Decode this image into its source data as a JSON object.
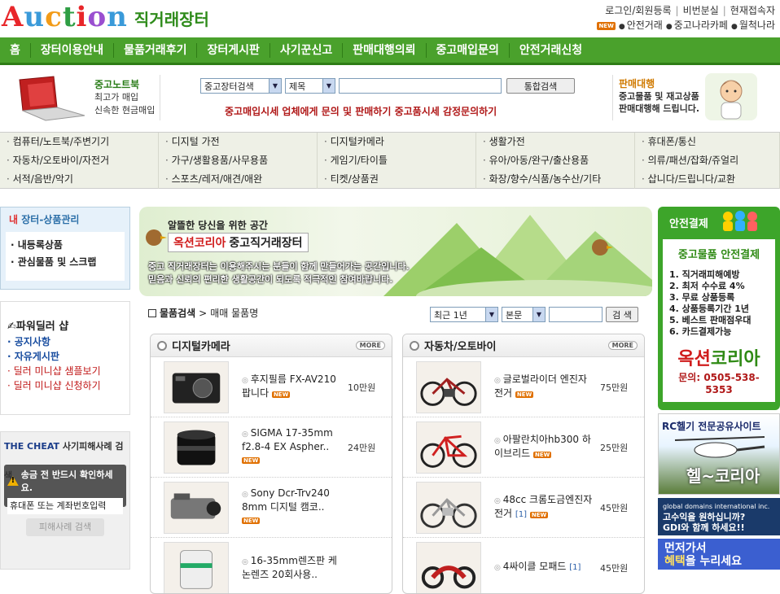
{
  "header": {
    "logo": "Auction",
    "logo_sub": "직거래장터",
    "links_top": [
      "로그인/회원등록",
      "비번분실",
      "현재접속자"
    ],
    "links_bottom": [
      "안전거래",
      "중고나라카페",
      "월척나라"
    ],
    "new_label": "NEW"
  },
  "nav": {
    "items": [
      "홈",
      "장터이용안내",
      "물품거래후기",
      "장터게시판",
      "사기꾼신고",
      "판매대행의뢰",
      "중고매입문의",
      "안전거래신청"
    ]
  },
  "promo": {
    "left_title": "중고노트북",
    "left_lines": [
      "최고가 매입",
      "신속한 현금매입"
    ],
    "search_scope": "중고장터검색",
    "search_field": "제목",
    "search_button": "통합검색",
    "notice": "중고매입시세 업체에게 문의 및 판매하기 중고품시세 감정문의하기",
    "right_title": "판매대행",
    "right_lines": [
      "중고물품 및 재고상품",
      "판매대행해 드립니다."
    ]
  },
  "categories": [
    "컴퓨터/노트북/주변기기",
    "디지털 가전",
    "디지털카메라",
    "생활가전",
    "휴대폰/통신",
    "자동차/오토바이/자전거",
    "가구/생활용품/사무용품",
    "게임기/타이틀",
    "유아/아동/완구/출산용품",
    "의류/패션/잡화/쥬얼리",
    "서적/음반/악기",
    "스포츠/레저/애견/애완",
    "티켓/상품권",
    "화장/향수/식품/농수산/기타",
    "삽니다/드립니다/교환"
  ],
  "sidebar": {
    "title_prefix": "내",
    "title": "장터-상품관리",
    "items": [
      "· 내등록상품",
      "· 관심물품 및 스크랩"
    ],
    "power_title": "파워딜러 샵",
    "power_links": [
      "· 공지사항",
      "· 자유게시판"
    ],
    "dealer_links": [
      "· 딜러 미니샵 샘플보기",
      "· 딜러 미니샵 신청하기"
    ],
    "cheat_brand": "THE CHEAT",
    "cheat_title": "사기피해사례 검색",
    "cheat_warn": "송금 전 반드시 확인하세요.",
    "cheat_placeholder": "휴대폰 또는 계좌번호입력",
    "cheat_button": "피해사례 검색"
  },
  "banner": {
    "tagline": "알뜰한 당신을 위한 공간",
    "name": "옥션코리아",
    "name_suffix": "중고직거래장터",
    "desc1": "중고 직거래장터는 이용해주시는 분들이 함께 만들어가는 공간입니다.",
    "desc2": "믿음과 신뢰의 편리한 생활공간이 되도록 적극적인 참여바랍니다."
  },
  "list": {
    "breadcrumb_1": "물품검색",
    "breadcrumb_sep": ">",
    "breadcrumb_2": "매매 물품명",
    "period": "최근 1년",
    "field": "본문",
    "search_button": "검 색"
  },
  "panels": [
    {
      "title": "디지털카메라",
      "more": "MORE",
      "items": [
        {
          "title": "후지필름 FX-AV210 팝니다",
          "price": "10만원",
          "count": "",
          "new": true,
          "thumb": "camera-black"
        },
        {
          "title": "SIGMA 17-35mm f2.8-4 EX Aspher..",
          "price": "24만원",
          "count": "",
          "new": true,
          "thumb": "lens"
        },
        {
          "title": "Sony Dcr-Trv240 8mm 디지털 캠코..",
          "price": "",
          "count": "",
          "new": true,
          "thumb": "camcorder"
        },
        {
          "title": "16-35mm렌즈판 케논렌즈 20회사용..",
          "price": "",
          "count": "",
          "new": false,
          "thumb": "lens-white"
        }
      ]
    },
    {
      "title": "자동차/오토바이",
      "more": "MORE",
      "items": [
        {
          "title": "글로벌라이더 엔진자전거",
          "price": "75만원",
          "count": "",
          "new": true,
          "thumb": "bike-engine"
        },
        {
          "title": "아팔란치아hb300 하이브리드",
          "price": "25만원",
          "count": "",
          "new": true,
          "thumb": "bike-red"
        },
        {
          "title": "48cc 크롬도금엔진자전거",
          "price": "45만원",
          "count": "[1]",
          "new": true,
          "thumb": "bike-chrome"
        },
        {
          "title": "4싸이클 모패드",
          "price": "45만원",
          "count": "[1]",
          "new": false,
          "thumb": "moped"
        }
      ]
    }
  ],
  "right": {
    "safe_title": "안전결제",
    "safe_sub": "중고물품 안전결제",
    "safe_items": [
      "1. 직거래피해예방",
      "2. 최저 수수료 4%",
      "3. 무료 상품등록",
      "4. 상품등록기간 1년",
      "5. 베스트 판매점우대",
      "6. 카드결제가능"
    ],
    "brand_a": "옥션",
    "brand_b": "코리아",
    "tel": "문의: 0505-538-5353",
    "ad1_title": "RC헬기 전문공유사이트",
    "ad1_name": "헬~코리아",
    "ad2_line1": "global domains international inc.",
    "ad2_line2": "고수익을 원하십니까?",
    "ad2_line3": "GDI와 함께 하세요!!",
    "ad3_line1": "먼저가서",
    "ad3_line2": "혜택",
    "ad3_line3": "을 누리세요"
  },
  "colors": {
    "nav": "#4aa12c",
    "accent_red": "#b01818",
    "accent_green": "#2f8a14"
  }
}
